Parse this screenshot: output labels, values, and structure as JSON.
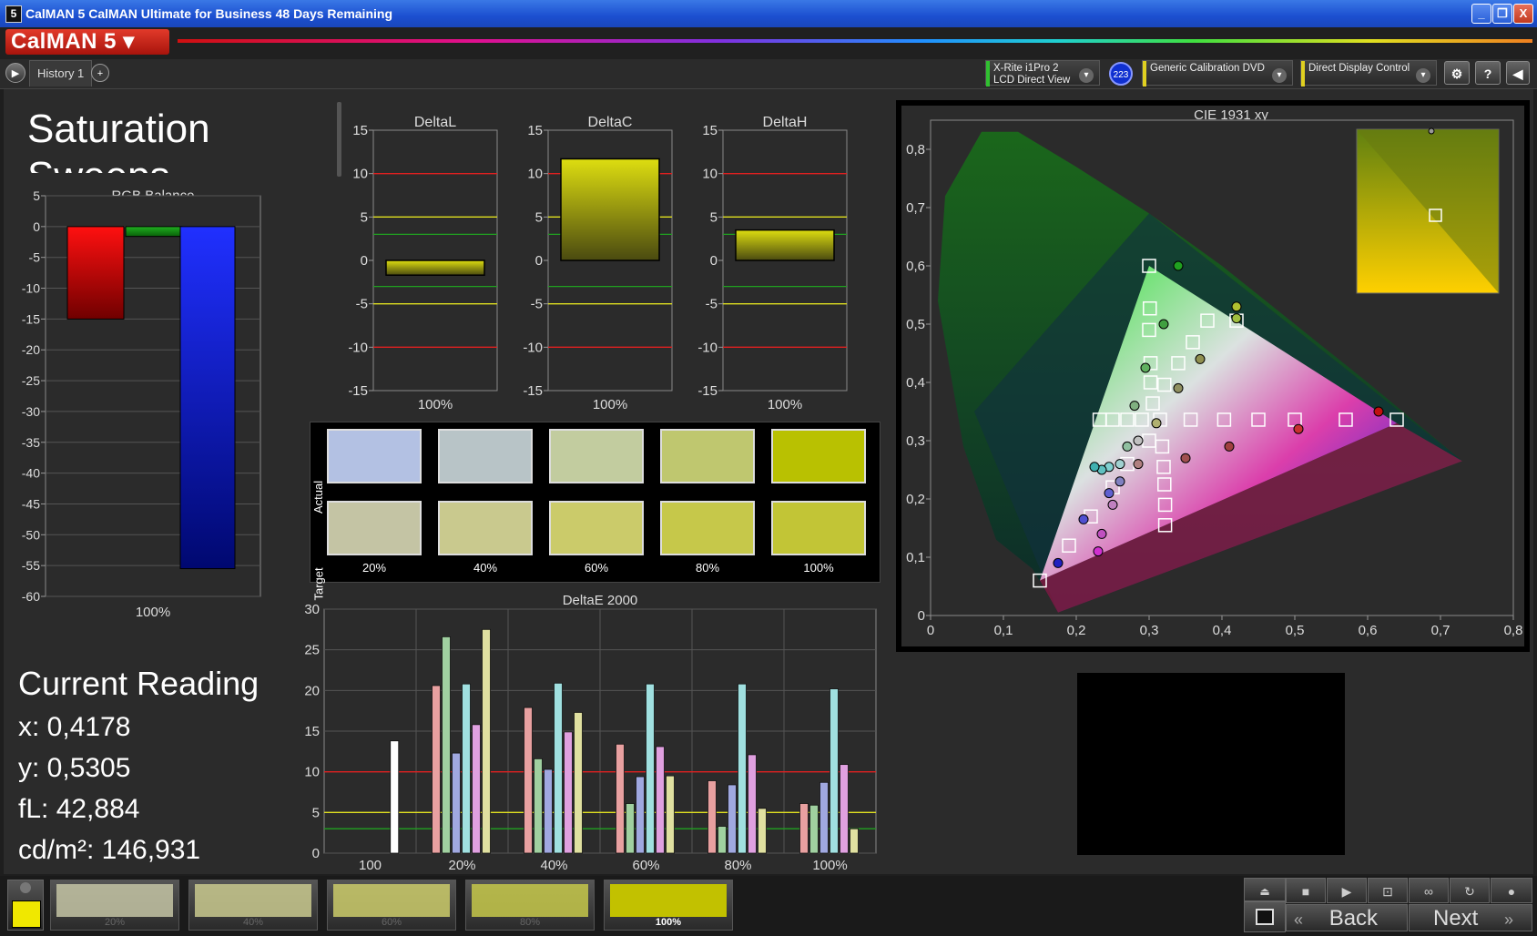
{
  "window": {
    "title": "CalMAN 5 CalMAN Ultimate for Business 48 Days Remaining",
    "minimize": "_",
    "maximize": "❐",
    "close": "X"
  },
  "app": {
    "logo_text": "CalMAN 5 ▾"
  },
  "tabs": {
    "history_tab": "History 1",
    "add_tab": "+",
    "menu_arrow": "▶"
  },
  "devices": {
    "meter": {
      "line1": "X-Rite i1Pro 2",
      "line2": "LCD Direct View",
      "badge": "223",
      "color": "#30c030"
    },
    "source": {
      "line1": "Generic Calibration DVD",
      "color": "#e0d020"
    },
    "display": {
      "line1": "Direct Display Control",
      "color": "#e0d020"
    },
    "icons": {
      "settings": "gear-icon",
      "help": "?",
      "collapse": "◀"
    }
  },
  "page": {
    "title": "Saturation Sweeps"
  },
  "current_reading": {
    "heading": "Current Reading",
    "x": "x: 0,4178",
    "y": "y: 0,5305",
    "fl": "fL: 42,884",
    "cdm2": "cd/m²: 146,931"
  },
  "chart_data": [
    {
      "type": "bar",
      "title": "RGB Balance",
      "categories": [
        "100%"
      ],
      "series": [
        {
          "name": "Red",
          "values": [
            -15
          ],
          "color": "#e01010"
        },
        {
          "name": "Green",
          "values": [
            -1.6
          ],
          "color": "#1a9a1a"
        },
        {
          "name": "Blue",
          "values": [
            -55.5
          ],
          "color": "#1020f0"
        }
      ],
      "ylim": [
        -60,
        5
      ],
      "yticks": [
        "5",
        "0",
        "-5",
        "-10",
        "-15",
        "-20",
        "-25",
        "-30",
        "-35",
        "-40",
        "-45",
        "-50",
        "-55",
        "-60"
      ]
    },
    {
      "type": "bar",
      "title": "DeltaL",
      "categories": [
        "100%"
      ],
      "values": [
        -1.7
      ],
      "ylim": [
        -15,
        15
      ],
      "yticks": [
        "15",
        "10",
        "5",
        "0",
        "-5",
        "-10",
        "-15"
      ],
      "ref_lines": [
        {
          "value": 10,
          "color": "#e02020"
        },
        {
          "value": 5,
          "color": "#e0e020"
        },
        {
          "value": 3,
          "color": "#20a020"
        },
        {
          "value": -3,
          "color": "#20a020"
        },
        {
          "value": -5,
          "color": "#e0e020"
        },
        {
          "value": -10,
          "color": "#e02020"
        }
      ]
    },
    {
      "type": "bar",
      "title": "DeltaC",
      "categories": [
        "100%"
      ],
      "values": [
        11.7
      ],
      "ylim": [
        -15,
        15
      ],
      "yticks": [
        "15",
        "10",
        "5",
        "0",
        "-5",
        "-10",
        "-15"
      ]
    },
    {
      "type": "bar",
      "title": "DeltaH",
      "categories": [
        "100%"
      ],
      "values": [
        3.5
      ],
      "ylim": [
        -15,
        15
      ],
      "yticks": [
        "15",
        "10",
        "5",
        "0",
        "-5",
        "-10",
        "-15"
      ]
    },
    {
      "type": "bar",
      "title": "DeltaE 2000",
      "categories": [
        "100",
        "20%",
        "40%",
        "60%",
        "80%",
        "100%"
      ],
      "ylim": [
        0,
        30
      ],
      "yticks": [
        "30",
        "25",
        "20",
        "15",
        "10",
        "5",
        "0"
      ],
      "ref_lines": [
        {
          "value": 10,
          "color": "#e02020"
        },
        {
          "value": 5,
          "color": "#e0e020"
        },
        {
          "value": 3,
          "color": "#20a020"
        }
      ],
      "series_colors": [
        "#e8a0a0",
        "#a0d0a0",
        "#a0a8e0",
        "#a0e0e0",
        "#e0a0e0",
        "#e0e0a0"
      ],
      "groups": [
        {
          "category": "100",
          "values": [
            13.8
          ],
          "colors": [
            "#ffffff"
          ]
        },
        {
          "category": "20%",
          "values": [
            20.6,
            26.6,
            12.3,
            20.8,
            15.8,
            27.5
          ]
        },
        {
          "category": "40%",
          "values": [
            17.9,
            11.6,
            10.3,
            20.9,
            14.9,
            17.3
          ]
        },
        {
          "category": "60%",
          "values": [
            13.4,
            6.1,
            9.4,
            20.8,
            13.1,
            9.5
          ]
        },
        {
          "category": "80%",
          "values": [
            8.9,
            3.3,
            8.4,
            20.8,
            12.1,
            5.5
          ]
        },
        {
          "category": "100%",
          "values": [
            6.1,
            5.9,
            8.7,
            20.2,
            10.9,
            3.0
          ]
        }
      ]
    },
    {
      "type": "scatter",
      "title": "CIE 1931 xy",
      "xlim": [
        0,
        0.8
      ],
      "ylim": [
        0,
        0.85
      ],
      "xticks": [
        "0",
        "0,1",
        "0,2",
        "0,3",
        "0,4",
        "0,5",
        "0,6",
        "0,7",
        "0,8"
      ],
      "yticks": [
        "0",
        "0,1",
        "0,2",
        "0,3",
        "0,4",
        "0,5",
        "0,6",
        "0,7",
        "0,8"
      ],
      "gamut_triangle": [
        [
          0.64,
          0.33
        ],
        [
          0.3,
          0.6
        ],
        [
          0.15,
          0.06
        ]
      ],
      "white_point": [
        0.3127,
        0.329
      ],
      "targets": [
        [
          0.357,
          0.336
        ],
        [
          0.403,
          0.336
        ],
        [
          0.45,
          0.336
        ],
        [
          0.5,
          0.336
        ],
        [
          0.57,
          0.336
        ],
        [
          0.64,
          0.336
        ],
        [
          0.305,
          0.364
        ],
        [
          0.302,
          0.4
        ],
        [
          0.302,
          0.433
        ],
        [
          0.3,
          0.49
        ],
        [
          0.301,
          0.527
        ],
        [
          0.3,
          0.6
        ],
        [
          0.321,
          0.396
        ],
        [
          0.34,
          0.433
        ],
        [
          0.36,
          0.469
        ],
        [
          0.38,
          0.506
        ],
        [
          0.42,
          0.506
        ],
        [
          0.3,
          0.3
        ],
        [
          0.27,
          0.26
        ],
        [
          0.25,
          0.22
        ],
        [
          0.22,
          0.17
        ],
        [
          0.19,
          0.12
        ],
        [
          0.15,
          0.06
        ],
        [
          0.318,
          0.29
        ],
        [
          0.32,
          0.255
        ],
        [
          0.321,
          0.225
        ],
        [
          0.322,
          0.19
        ],
        [
          0.322,
          0.155
        ],
        [
          0.29,
          0.336
        ],
        [
          0.27,
          0.336
        ],
        [
          0.25,
          0.336
        ],
        [
          0.232,
          0.336
        ],
        [
          0.315,
          0.336
        ]
      ],
      "measured": [
        {
          "xy": [
            0.615,
            0.35
          ],
          "color": "#c01010"
        },
        {
          "xy": [
            0.505,
            0.32
          ],
          "color": "#c83030"
        },
        {
          "xy": [
            0.41,
            0.29
          ],
          "color": "#a04040"
        },
        {
          "xy": [
            0.35,
            0.27
          ],
          "color": "#a05050"
        },
        {
          "xy": [
            0.34,
            0.6
          ],
          "color": "#20a020"
        },
        {
          "xy": [
            0.32,
            0.5
          ],
          "color": "#40a040"
        },
        {
          "xy": [
            0.295,
            0.425
          ],
          "color": "#60b060"
        },
        {
          "xy": [
            0.28,
            0.36
          ],
          "color": "#80b080"
        },
        {
          "xy": [
            0.42,
            0.53
          ],
          "color": "#b0c030"
        },
        {
          "xy": [
            0.42,
            0.51
          ],
          "color": "#a0c040"
        },
        {
          "xy": [
            0.37,
            0.44
          ],
          "color": "#909050"
        },
        {
          "xy": [
            0.34,
            0.39
          ],
          "color": "#909060"
        },
        {
          "xy": [
            0.31,
            0.33
          ],
          "color": "#b0b070"
        },
        {
          "xy": [
            0.27,
            0.29
          ],
          "color": "#90c0a0"
        },
        {
          "xy": [
            0.285,
            0.3
          ],
          "color": "#c0c0c0"
        },
        {
          "xy": [
            0.26,
            0.26
          ],
          "color": "#a0d0d0"
        },
        {
          "xy": [
            0.245,
            0.255
          ],
          "color": "#80d0d0"
        },
        {
          "xy": [
            0.235,
            0.25
          ],
          "color": "#60c0c0"
        },
        {
          "xy": [
            0.225,
            0.255
          ],
          "color": "#40b0b0"
        },
        {
          "xy": [
            0.285,
            0.26
          ],
          "color": "#b08080"
        },
        {
          "xy": [
            0.26,
            0.23
          ],
          "color": "#8080c0"
        },
        {
          "xy": [
            0.245,
            0.21
          ],
          "color": "#6060d0"
        },
        {
          "xy": [
            0.25,
            0.19
          ],
          "color": "#c080c0"
        },
        {
          "xy": [
            0.235,
            0.14
          ],
          "color": "#c050c0"
        },
        {
          "xy": [
            0.23,
            0.11
          ],
          "color": "#d030d0"
        },
        {
          "xy": [
            0.21,
            0.165
          ],
          "color": "#5050d0"
        },
        {
          "xy": [
            0.175,
            0.09
          ],
          "color": "#2020c0"
        }
      ]
    }
  ],
  "swatches": {
    "row_actual": "Actual",
    "row_target": "Target",
    "labels": [
      "20%",
      "40%",
      "60%",
      "80%",
      "100%"
    ],
    "actual_colors": [
      "#b3c1e3",
      "#b8c4c7",
      "#c2cc9f",
      "#bfc76f",
      "#b9c101"
    ],
    "target_colors": [
      "#c4c4a4",
      "#c9c98e",
      "#cbcb6a",
      "#c6c84a",
      "#c2c536"
    ]
  },
  "bottom_bar": {
    "thumb_labels": [
      "20%",
      "40%",
      "60%",
      "80%",
      "100%"
    ],
    "thumb_colors": [
      "#c4c4a4",
      "#c9c98e",
      "#cbcb6a",
      "#c6c84a",
      "#c2c100"
    ],
    "selected_index": 4,
    "back_label": "Back",
    "next_label": "Next"
  }
}
